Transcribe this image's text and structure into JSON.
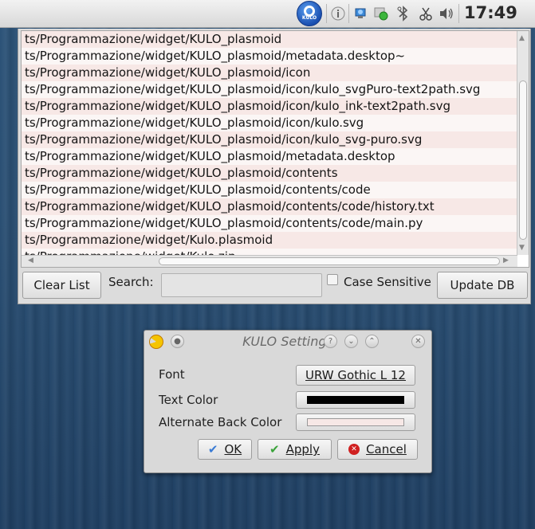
{
  "panel": {
    "kulo_badge": "KULO",
    "clock": "17:49",
    "tray_icons": [
      "info-icon",
      "network-icon",
      "update-icon",
      "bluetooth-icon",
      "scissors-icon",
      "volume-icon"
    ]
  },
  "main": {
    "file_list": [
      "ts/Programmazione/widget/KULO_plasmoid",
      "ts/Programmazione/widget/KULO_plasmoid/metadata.desktop~",
      "ts/Programmazione/widget/KULO_plasmoid/icon",
      "ts/Programmazione/widget/KULO_plasmoid/icon/kulo_svgPuro-text2path.svg",
      "ts/Programmazione/widget/KULO_plasmoid/icon/kulo_ink-text2path.svg",
      "ts/Programmazione/widget/KULO_plasmoid/icon/kulo.svg",
      "ts/Programmazione/widget/KULO_plasmoid/icon/kulo_svg-puro.svg",
      "ts/Programmazione/widget/KULO_plasmoid/metadata.desktop",
      "ts/Programmazione/widget/KULO_plasmoid/contents",
      "ts/Programmazione/widget/KULO_plasmoid/contents/code",
      "ts/Programmazione/widget/KULO_plasmoid/contents/code/history.txt",
      "ts/Programmazione/widget/KULO_plasmoid/contents/code/main.py",
      "ts/Programmazione/widget/Kulo.plasmoid",
      "ts/Programmazione/widget/Kulo.zip"
    ],
    "clear_list_label": "Clear List",
    "search_label": "Search:",
    "search_value": "",
    "case_sensitive_label": "Case Sensitive",
    "case_sensitive_checked": false,
    "update_db_label": "Update DB"
  },
  "dialog": {
    "title": "KULO Settings",
    "font_label": "Font",
    "font_value": "URW Gothic L 12",
    "text_color_label": "Text Color",
    "text_color_value": "#000000",
    "alt_back_color_label": "Alternate Back Color",
    "alt_back_color_value": "#f7e8e6",
    "ok_label": "OK",
    "apply_label": "Apply",
    "cancel_label": "Cancel"
  }
}
